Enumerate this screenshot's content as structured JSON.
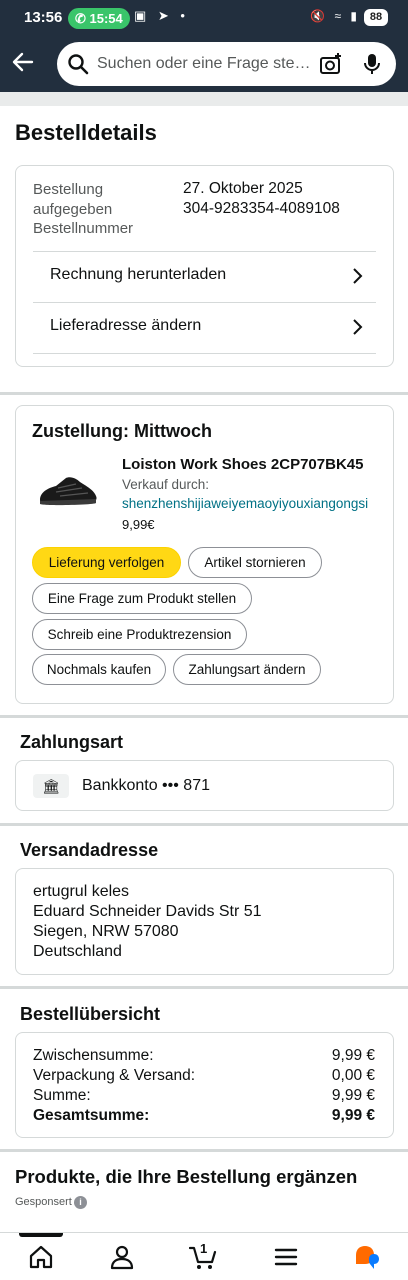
{
  "status_bar": {
    "time": "13:56",
    "call_time": "15:54",
    "battery": "88"
  },
  "search": {
    "placeholder": "Suchen oder eine Frage stellen"
  },
  "page": {
    "title": "Bestelldetails"
  },
  "order": {
    "placed_label": "Bestellung aufgegeben",
    "placed_value": "27. Oktober 2025",
    "number_label": "Bestellnummer",
    "number_value": "304-9283354-4089108",
    "links": [
      "Rechnung herunterladen",
      "Lieferadresse ändern"
    ]
  },
  "delivery": {
    "title": "Zustellung: Mittwoch",
    "product_name": "Loiston Work Shoes 2CP707BK45",
    "seller_label": "Verkauf durch:",
    "seller": "shenzhenshijiaweiyemaoyiyouxiangongsi",
    "price": "9,99€",
    "actions": {
      "track": "Lieferung verfolgen",
      "cancel": "Artikel stornieren",
      "question": "Eine Frage zum Produkt stellen",
      "review": "Schreib eine Produktrezension",
      "rebuy": "Nochmals kaufen",
      "change_payment": "Zahlungsart ändern"
    }
  },
  "payment": {
    "title": "Zahlungsart",
    "method": "Bankkonto ••• 871",
    "icon": "bank-icon"
  },
  "shipping": {
    "title": "Versandadresse",
    "lines": [
      "ertugrul keles",
      "Eduard Schneider Davids Str 51",
      "Siegen, NRW 57080",
      "Deutschland"
    ]
  },
  "summary": {
    "title": "Bestellübersicht",
    "rows": [
      {
        "label": "Zwischensumme:",
        "value": "9,99 €"
      },
      {
        "label": "Verpackung & Versand:",
        "value": "0,00 €"
      },
      {
        "label": "Summe:",
        "value": "9,99 €"
      },
      {
        "label": "Gesamtsumme:",
        "value": "9,99 €"
      }
    ]
  },
  "recommendations": {
    "title": "Produkte, die Ihre Bestellung ergänzen",
    "sponsored": "Gesponsert"
  },
  "bottom_nav": {
    "cart_count": "1",
    "items": [
      "home-icon",
      "account-icon",
      "cart-icon",
      "menu-icon",
      "rufus-icon"
    ]
  }
}
